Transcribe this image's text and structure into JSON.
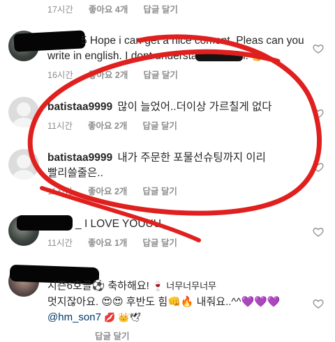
{
  "comments": [
    {
      "time": "17시간",
      "likes": "좋아요 4개",
      "reply": "답글 달기"
    },
    {
      "text": "5 Hope i can get a nice coment. Pleas can you write in english. I dont understand korean.",
      "emoji": "👍",
      "time": "16시간",
      "likes": "좋아요 2개",
      "reply": "답글 달기"
    },
    {
      "username": "batistaa9999",
      "text": "많이 늘었어..더이상 가르칠게 없다",
      "time": "11시간",
      "likes": "좋아요 2개",
      "reply": "답글 달기"
    },
    {
      "username": "batistaa9999",
      "text": "내가 주문한 포물선슈팅까지 이리 빨리쓸줄은..",
      "time": "11시간",
      "likes": "좋아요 2개",
      "reply": "답글 달기"
    },
    {
      "text": "I LOVE YOUUU",
      "prefix": "_",
      "time": "11시간",
      "likes": "좋아요 1개",
      "reply": "답글 달기"
    },
    {
      "text_line1": "시즌6호골⚽ 축하해요!",
      "text_line1b": "🍷 너무너무너무",
      "text_line2": "멋지잖아요. 😍😍 후반도 힘👊🔥 내줘요..^^💜💜💜",
      "mention": "@hm_son7",
      "text_line3_tail": "💋 👑🕊",
      "reply": "답글 달기"
    }
  ],
  "icons": {
    "heart": "heart-outline-icon"
  },
  "colors": {
    "scribble": "#e0201e",
    "redaction": "#050505",
    "meta": "#8e8e8e"
  }
}
